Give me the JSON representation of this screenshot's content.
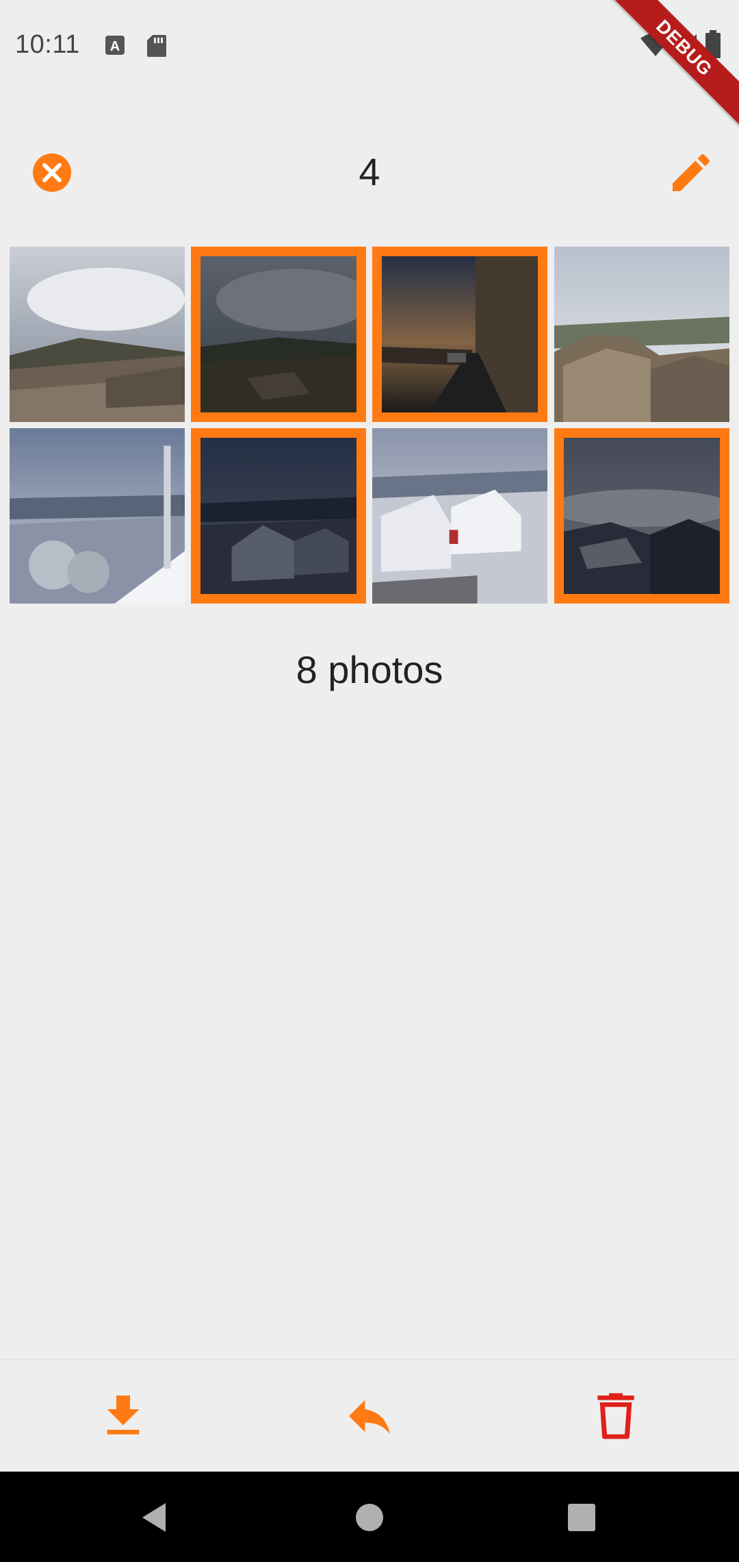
{
  "status_bar": {
    "time": "10:11",
    "icons": [
      "text-notification-icon",
      "sd-card-icon",
      "wifi-icon",
      "signal-icon",
      "battery-icon"
    ],
    "debug_banner": "DEBUG"
  },
  "app_bar": {
    "selected_count": "4",
    "close_icon": "close-circle-icon",
    "edit_icon": "pencil-icon"
  },
  "colors": {
    "accent": "#ff7a12",
    "delete": "#e0201a",
    "background": "#eeeeee"
  },
  "grid": {
    "photos": [
      {
        "scene": "cloudy-rooftop",
        "selected": false
      },
      {
        "scene": "stormy-valley",
        "selected": true
      },
      {
        "scene": "village-street",
        "selected": true
      },
      {
        "scene": "stone-houses",
        "selected": false
      },
      {
        "scene": "snowy-trees",
        "selected": false
      },
      {
        "scene": "snowy-village-dusk",
        "selected": true
      },
      {
        "scene": "snowy-rooftops",
        "selected": false
      },
      {
        "scene": "snowy-roofs-mist",
        "selected": true
      }
    ]
  },
  "footer": {
    "photo_count": "8 photos"
  },
  "toolbar": {
    "items": [
      {
        "icon": "download-icon"
      },
      {
        "icon": "reply-icon"
      },
      {
        "icon": "delete-icon"
      }
    ]
  },
  "nav": {
    "items": [
      "back-icon",
      "home-icon",
      "recents-icon"
    ]
  }
}
